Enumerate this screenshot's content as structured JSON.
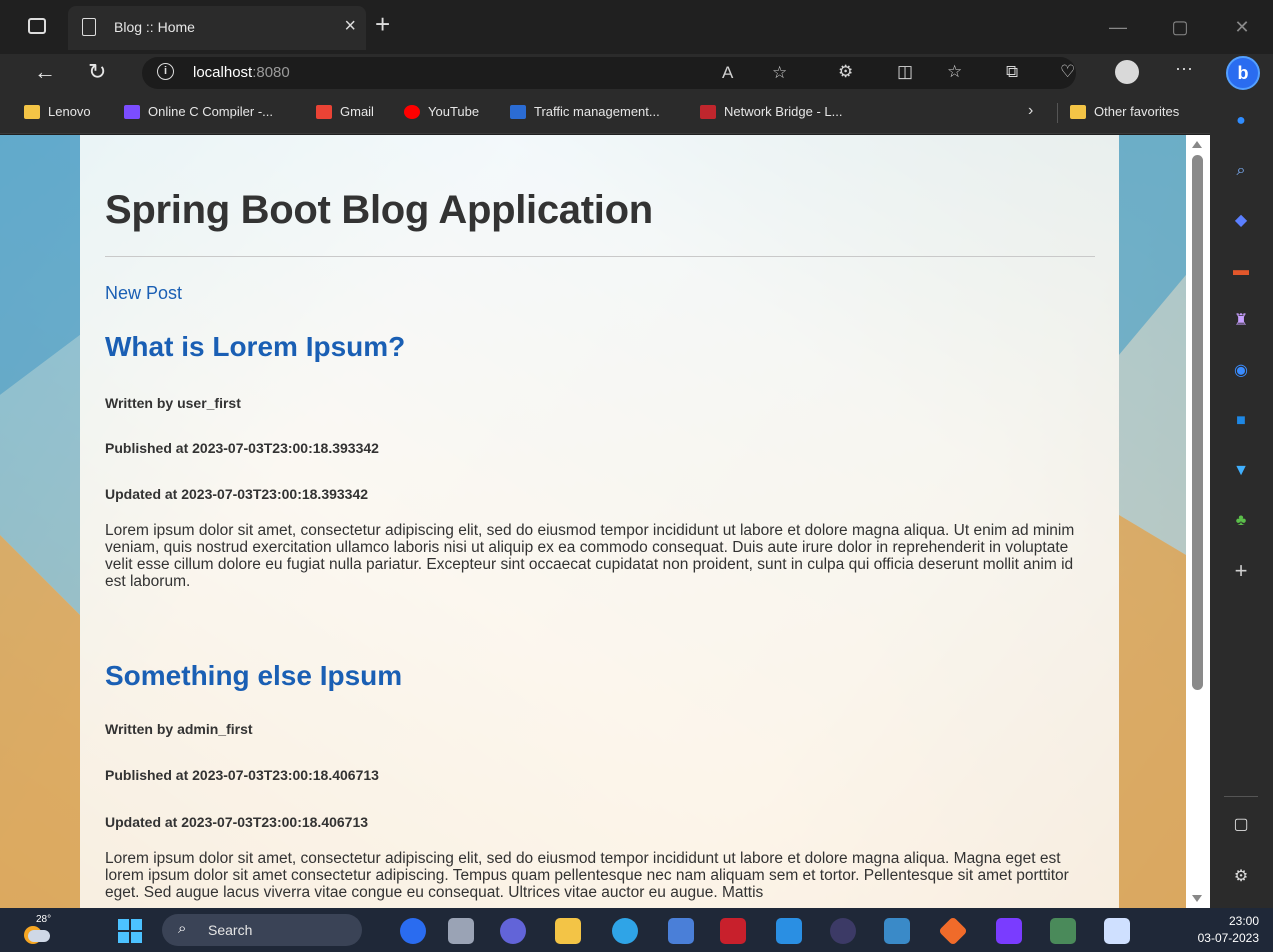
{
  "browser": {
    "tab_title": "Blog :: Home",
    "tab_close": "×",
    "new_tab": "+",
    "url_host": "localhost",
    "url_port": ":8080",
    "info_glyph": "i",
    "more_glyph": "···",
    "bing_glyph": "b",
    "window_buttons": [
      "—",
      "▢",
      "✕"
    ]
  },
  "favorites": {
    "items": [
      {
        "label": "Lenovo",
        "icon": "folder-icon",
        "color": "#f3c446"
      },
      {
        "label": "Online C Compiler -...",
        "icon": "bolt-icon",
        "color": "#7b4dff"
      },
      {
        "label": "Gmail",
        "icon": "gmail-icon",
        "color": "#ea4335"
      },
      {
        "label": "YouTube",
        "icon": "youtube-icon",
        "color": "#ff0000"
      },
      {
        "label": "Traffic management...",
        "icon": "site-icon",
        "color": "#2b6cd4"
      },
      {
        "label": "Network Bridge - L...",
        "icon": "site-icon",
        "color": "#c0262d"
      }
    ],
    "chevron": "›",
    "other_favorites": "Other favorites"
  },
  "page": {
    "heading": "Spring Boot Blog Application",
    "new_post_link": "New Post",
    "posts": [
      {
        "title": "What is Lorem Ipsum?",
        "author_line": "Written by user_first",
        "published_line": "Published at 2023-07-03T23:00:18.393342",
        "updated_line": "Updated at 2023-07-03T23:00:18.393342",
        "body": "Lorem ipsum dolor sit amet, consectetur adipiscing elit, sed do eiusmod tempor incididunt ut labore et dolore magna aliqua. Ut enim ad minim veniam, quis nostrud exercitation ullamco laboris nisi ut aliquip ex ea commodo consequat. Duis aute irure dolor in reprehenderit in voluptate velit esse cillum dolore eu fugiat nulla pariatur. Excepteur sint occaecat cupidatat non proident, sunt in culpa qui officia deserunt mollit anim id est laborum."
      },
      {
        "title": "Something else Ipsum",
        "author_line": "Written by admin_first",
        "published_line": "Published at 2023-07-03T23:00:18.406713",
        "updated_line": "Updated at 2023-07-03T23:00:18.406713",
        "body": "Lorem ipsum dolor sit amet, consectetur adipiscing elit, sed do eiusmod tempor incididunt ut labore et dolore magna aliqua. Magna eget est lorem ipsum dolor sit amet consectetur adipiscing. Tempus quam pellentesque nec nam aliquam sem et tortor. Pellentesque sit amet porttitor eget. Sed augue lacus viverra vitae congue eu consequat. Ultrices vitae auctor eu augue. Mattis"
      }
    ]
  },
  "taskbar": {
    "temperature": "28°",
    "search_label": "Search",
    "time": "23:00",
    "date": "03-07-2023"
  },
  "colors": {
    "link": "#1a5fb4",
    "accent": "#4cc2ff"
  }
}
